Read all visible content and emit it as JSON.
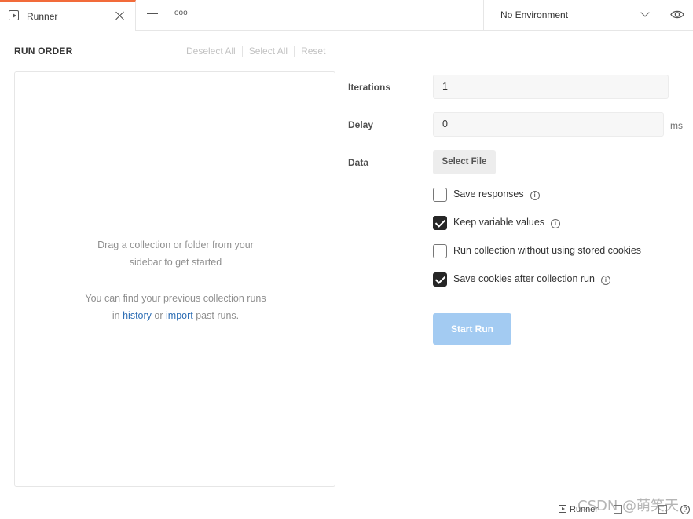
{
  "tabs": {
    "active_tab_label": "Runner",
    "more_tabs_glyph": "ooo"
  },
  "environment": {
    "selected": "No Environment"
  },
  "run_order": {
    "title": "RUN ORDER",
    "deselect_all": "Deselect All",
    "select_all": "Select All",
    "reset": "Reset",
    "empty_line1": "Drag a collection or folder from your",
    "empty_line2": "sidebar to get started",
    "history_line1": "You can find your previous collection runs",
    "history_prefix": "in",
    "history_link": "history",
    "history_or": "or",
    "import_link": "import",
    "history_suffix": "past runs."
  },
  "settings": {
    "iterations_label": "Iterations",
    "iterations_value": "1",
    "delay_label": "Delay",
    "delay_value": "0",
    "delay_unit": "ms",
    "data_label": "Data",
    "select_file": "Select File",
    "options": [
      {
        "label": "Save responses",
        "checked": false,
        "info": true
      },
      {
        "label": "Keep variable values",
        "checked": true,
        "info": true
      },
      {
        "label": "Run collection without using stored cookies",
        "checked": false,
        "info": false
      },
      {
        "label": "Save cookies after collection run",
        "checked": true,
        "info": true
      }
    ],
    "start_run": "Start Run"
  },
  "statusbar": {
    "runner_label": "Runner",
    "help_glyph": "?"
  },
  "watermark": "CSDN @萌笑天",
  "colors": {
    "active_tab_accent": "#f26b3a",
    "link": "#2f6fb5",
    "start_button": "#a3cbf2"
  }
}
